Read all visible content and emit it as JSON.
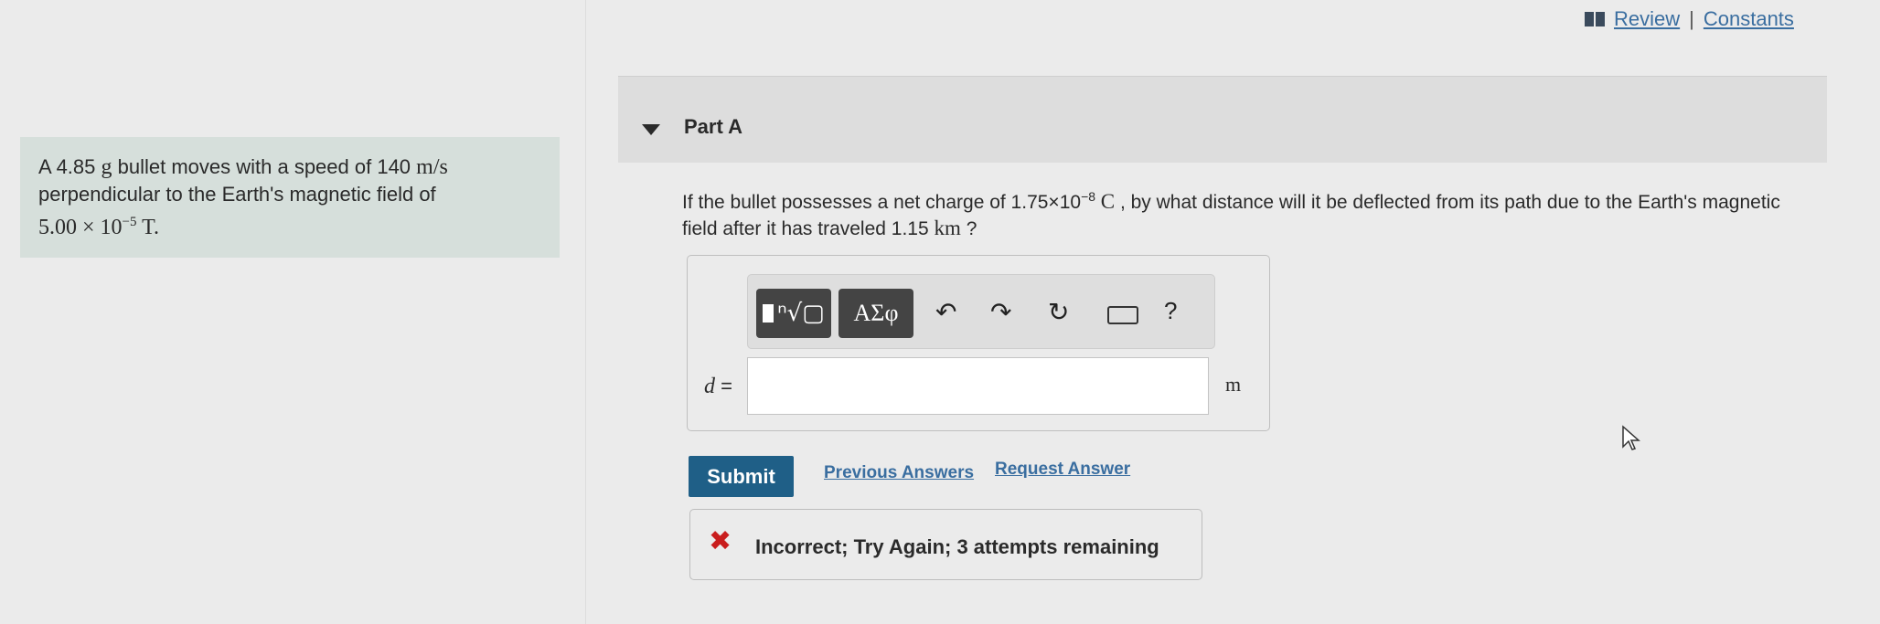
{
  "top_links": {
    "review": "Review",
    "separator": "|",
    "constants": "Constants"
  },
  "problem": {
    "t1": "A 4.85 ",
    "m_g": "g",
    "t2": " bullet moves with a speed of 140 ",
    "m_mps": "m/s",
    "line2": "perpendicular to the Earth's magnetic field of",
    "field_value": "5.00 × 10",
    "field_exp": "−5",
    "field_unit": " T."
  },
  "part": {
    "title": "Part A"
  },
  "question": {
    "t1": "If the bullet possesses a net charge of 1.75×10",
    "exp": "−8",
    "unit_c": " C",
    "t2": " , by what distance will it be deflected from its path due to the Earth's magnetic",
    "t3": "field after it has traveled 1.15 ",
    "unit_km": "km",
    "t4": " ?"
  },
  "toolbar": {
    "greek_label": "ΑΣφ",
    "undo": "↶",
    "redo": "↷",
    "reset": "↻",
    "help": "?"
  },
  "answer": {
    "variable": "d",
    "equals": " =",
    "value": "",
    "unit": "m"
  },
  "buttons": {
    "submit": "Submit",
    "previous_answers": "Previous Answers",
    "request_answer": "Request Answer"
  },
  "feedback": {
    "icon": "✖",
    "message": "Incorrect; Try Again; 3 attempts remaining"
  }
}
